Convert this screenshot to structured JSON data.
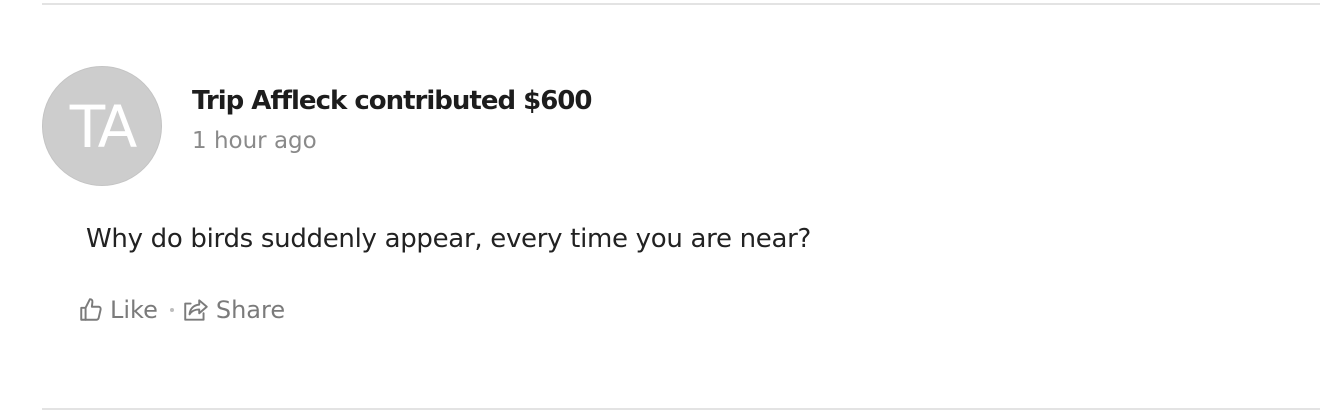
{
  "post": {
    "avatar_initials": "TA",
    "headline": "Trip Affleck contributed $600",
    "timestamp": "1 hour ago",
    "message": "Why do birds suddenly appear, every time you are near?"
  },
  "actions": {
    "like_label": "Like",
    "like_icon": "thumbs-up-icon",
    "share_label": "Share",
    "share_icon": "share-icon"
  },
  "colors": {
    "avatar_bg": "#cdcdcd",
    "muted_text": "#8a8a8a",
    "divider": "#e3e3e3"
  }
}
